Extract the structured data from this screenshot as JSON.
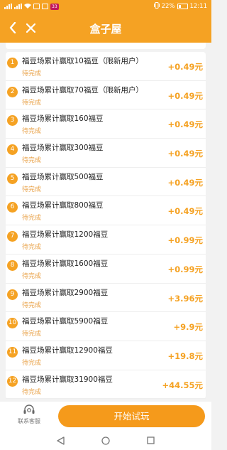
{
  "status_bar": {
    "left_badge": "33",
    "battery": "22%",
    "time": "12:11"
  },
  "header": {
    "title": "盒子屋"
  },
  "tasks": [
    {
      "index": "1",
      "title": "福豆场累计赢取10福豆（限新用户）",
      "status": "待完成",
      "reward": "+0.49元"
    },
    {
      "index": "2",
      "title": "福豆场累计赢取70福豆（限新用户）",
      "status": "待完成",
      "reward": "+0.49元"
    },
    {
      "index": "3",
      "title": "福豆场累计赢取160福豆",
      "status": "待完成",
      "reward": "+0.49元"
    },
    {
      "index": "4",
      "title": "福豆场累计赢取300福豆",
      "status": "待完成",
      "reward": "+0.49元"
    },
    {
      "index": "5",
      "title": "福豆场累计赢取500福豆",
      "status": "待完成",
      "reward": "+0.49元"
    },
    {
      "index": "6",
      "title": "福豆场累计赢取800福豆",
      "status": "待完成",
      "reward": "+0.49元"
    },
    {
      "index": "7",
      "title": "福豆场累计赢取1200福豆",
      "status": "待完成",
      "reward": "+0.99元"
    },
    {
      "index": "8",
      "title": "福豆场累计赢取1600福豆",
      "status": "待完成",
      "reward": "+0.99元"
    },
    {
      "index": "9",
      "title": "福豆场累计赢取2900福豆",
      "status": "待完成",
      "reward": "+3.96元"
    },
    {
      "index": "10",
      "title": "福豆场累计赢取5900福豆",
      "status": "待完成",
      "reward": "+9.9元"
    },
    {
      "index": "11",
      "title": "福豆场累计赢取12900福豆",
      "status": "待完成",
      "reward": "+19.8元"
    },
    {
      "index": "12",
      "title": "福豆场累计赢取31900福豆",
      "status": "待完成",
      "reward": "+44.55元"
    }
  ],
  "footer": {
    "support_label": "联系客服",
    "start_label": "开始试玩"
  },
  "colors": {
    "accent": "#f5a223",
    "status_text": "#e9a34a"
  }
}
